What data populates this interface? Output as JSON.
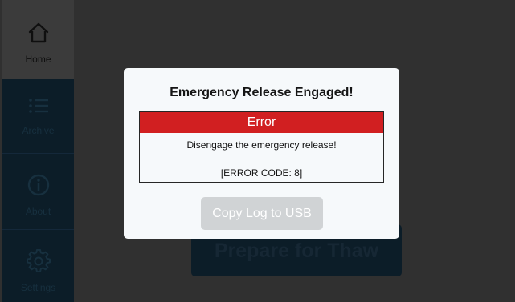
{
  "sidebar": {
    "items": [
      {
        "label": "Home",
        "icon": "home-icon"
      },
      {
        "label": "Archive",
        "icon": "list-icon"
      },
      {
        "label": "About",
        "icon": "info-icon"
      },
      {
        "label": "Settings",
        "icon": "gear-icon"
      }
    ]
  },
  "main": {
    "primary_button_label": "Prepare for Thaw"
  },
  "dialog": {
    "title": "Emergency Release Engaged!",
    "error_header": "Error",
    "message": "Disengage the emergency release!",
    "error_code": "[ERROR CODE: 8]",
    "copy_button_label": "Copy Log to USB"
  },
  "colors": {
    "error_red": "#d11f21",
    "modal_background": "#f6f9fb",
    "sidebar_dark": "#0c1d28",
    "disabled_button": "#d0d3d5"
  }
}
